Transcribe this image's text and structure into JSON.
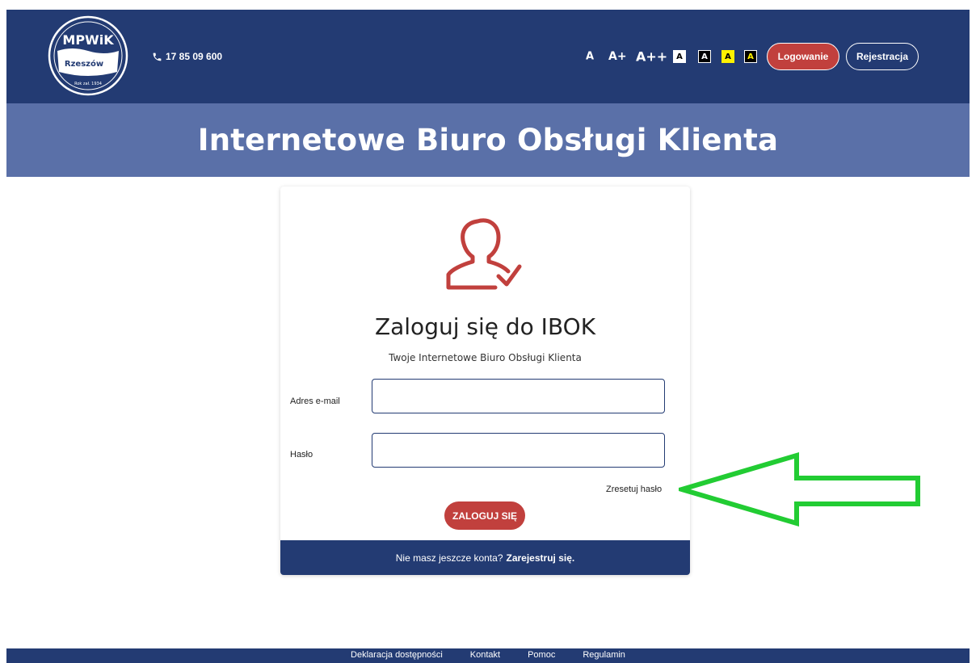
{
  "header": {
    "logo": {
      "name": "MPWiK",
      "city": "Rzeszów",
      "est": "Rok zał. 1934"
    },
    "phone": "17 85 09 600",
    "font_sizes": [
      "A",
      "A+",
      "A++"
    ],
    "contrast": [
      "A",
      "A",
      "A",
      "A"
    ],
    "login_label": "Logowanie",
    "register_label": "Rejestracja"
  },
  "banner": {
    "title": "Internetowe Biuro Obsługi Klienta"
  },
  "login": {
    "title": "Zaloguj się do IBOK",
    "subtitle": "Twoje Internetowe Biuro Obsługi Klienta",
    "email_label": "Adres e-mail",
    "email_value": "",
    "password_label": "Hasło",
    "password_value": "",
    "reset_label": "Zresetuj hasło",
    "submit_label": "ZALOGUJ SIĘ",
    "footer_text": "Nie masz jeszcze konta?",
    "footer_link": "Zarejestruj się."
  },
  "footer": {
    "links": [
      "Deklaracja dostępności",
      "Kontakt",
      "Pomoc",
      "Regulamin"
    ]
  },
  "colors": {
    "navy": "#233b73",
    "banner": "#5a70a8",
    "accent_red": "#c1403d",
    "highlight_yellow": "#fff200",
    "annotation_green": "#22cc33"
  },
  "icons": [
    "phone-icon",
    "user-check-icon",
    "annotation-arrow-icon"
  ]
}
